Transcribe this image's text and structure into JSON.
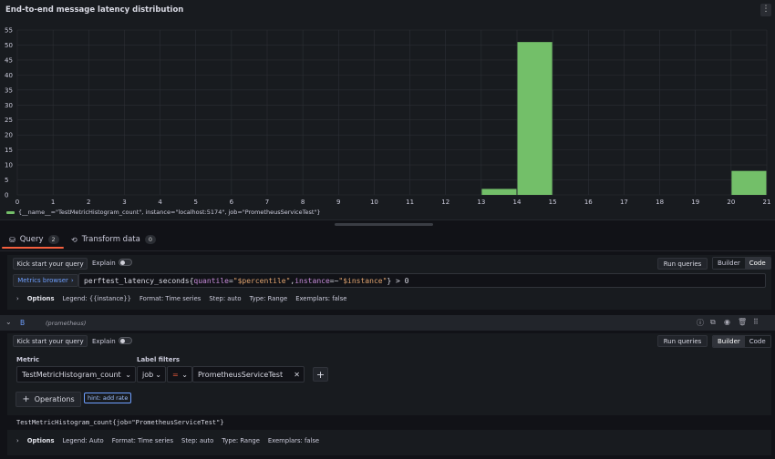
{
  "panel": {
    "title": "End-to-end message latency distribution",
    "menu_icon": "more-vertical-icon",
    "legend_label": "{__name__=\"TestMetricHistogram_count\", instance=\"localhost:5174\", job=\"PrometheusServiceTest\"}"
  },
  "chart_data": {
    "type": "bar",
    "x": [
      13,
      14,
      20
    ],
    "values": [
      2,
      51,
      8
    ],
    "bin_width": 1,
    "xlim": [
      0,
      21
    ],
    "ylim": [
      0,
      55
    ],
    "x_ticks": [
      "0",
      "1",
      "2",
      "3",
      "4",
      "5",
      "6",
      "7",
      "8",
      "9",
      "10",
      "11",
      "12",
      "13",
      "14",
      "15",
      "16",
      "17",
      "18",
      "19",
      "20",
      "21"
    ],
    "y_ticks": [
      "0",
      "5",
      "10",
      "15",
      "20",
      "25",
      "30",
      "35",
      "40",
      "45",
      "50",
      "55"
    ],
    "grid": true,
    "legend_placement": "bottom-left",
    "series_color": "#73bf69"
  },
  "tabs": [
    {
      "label": "Query",
      "count": "2",
      "icon": "database-icon"
    },
    {
      "label": "Transform data",
      "count": "0",
      "icon": "transform-icon"
    }
  ],
  "queryA": {
    "kick_start": "Kick start your query",
    "explain": "Explain",
    "run": "Run queries",
    "mode_builder": "Builder",
    "mode_code": "Code",
    "metrics_browser": "Metrics browser",
    "expr": {
      "p1": "perftest_latency_seconds{",
      "k1": "quantile",
      "eq1": "=",
      "v1": "\"$percentile\"",
      "comma": ",",
      "k2": "instance",
      "eq2": "=~",
      "v2": "\"$instance\"",
      "p2": "} > 0"
    },
    "options_label": "Options",
    "options": [
      "Legend: {{instance}}",
      "Format: Time series",
      "Step: auto",
      "Type: Range",
      "Exemplars: false"
    ]
  },
  "queryB": {
    "ref": "B",
    "datasource": "(prometheus)",
    "kick_start": "Kick start your query",
    "explain": "Explain",
    "run": "Run queries",
    "mode_builder": "Builder",
    "mode_code": "Code",
    "metric_label": "Metric",
    "metric_value": "TestMetricHistogram_count",
    "label_filters_label": "Label filters",
    "filter_key": "job",
    "filter_op": "=",
    "filter_value": "PrometheusServiceTest",
    "operations": "Operations",
    "hint": "hint: add rate",
    "preview": "TestMetricHistogram_count{job=\"PrometheusServiceTest\"}",
    "options_label": "Options",
    "options": [
      "Legend: Auto",
      "Format: Time series",
      "Step: auto",
      "Type: Range",
      "Exemplars: false"
    ]
  }
}
